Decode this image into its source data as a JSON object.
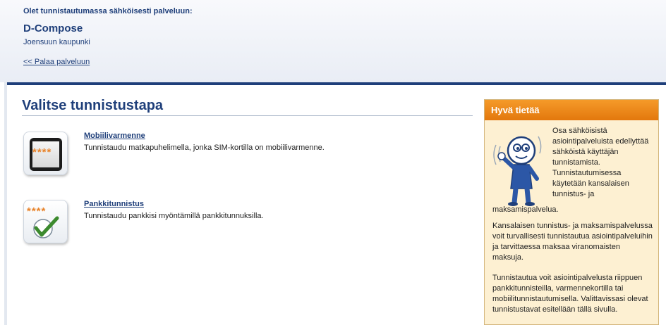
{
  "header": {
    "intro": "Olet tunnistautumassa sähköisesti palveluun:",
    "service_name": "D-Compose",
    "organization": "Joensuun kaupunki",
    "back_link": "<< Palaa palveluun"
  },
  "main": {
    "title": "Valitse tunnistustapa",
    "methods": [
      {
        "title": "Mobiilivarmenne",
        "description": "Tunnistaudu matkapuhelimella, jonka SIM-kortilla on mobiilivarmenne.",
        "icon": "mobile-phone-icon",
        "icon_text": "****"
      },
      {
        "title": "Pankkitunnistus",
        "description": "Tunnistaudu pankkisi myöntämillä pankkitunnuksilla.",
        "icon": "bank-checkmark-icon",
        "icon_text": "****"
      }
    ]
  },
  "sidebar": {
    "title": "Hyvä tietää",
    "p1_a": "Osa sähköisistä asiointipalveluista edellyttää sähköistä käyttäjän tunnistamista. Tunnistautumisessa käytetään kansalaisen tunnistus- ja",
    "p1_b": "maksamispalvelua.",
    "p2": "Kansalaisen tunnistus- ja maksamispalvelussa voit turvallisesti tunnistautua asiointipalveluihin ja tarvittaessa maksaa viranomaisten maksuja.",
    "p3": "Tunnistautua voit asiointipalvelusta riippuen pankkitunnisteilla, varmennekortilla tai mobiilitunnistautumisella. Valittavissasi olevat tunnistustavat esitellään tällä sivulla.",
    "mascot_icon": "waving-mascot-icon"
  },
  "colors": {
    "brand_blue": "#1f3f7a",
    "accent_orange": "#e8832a",
    "sidebar_bg": "#fdf0d2"
  }
}
